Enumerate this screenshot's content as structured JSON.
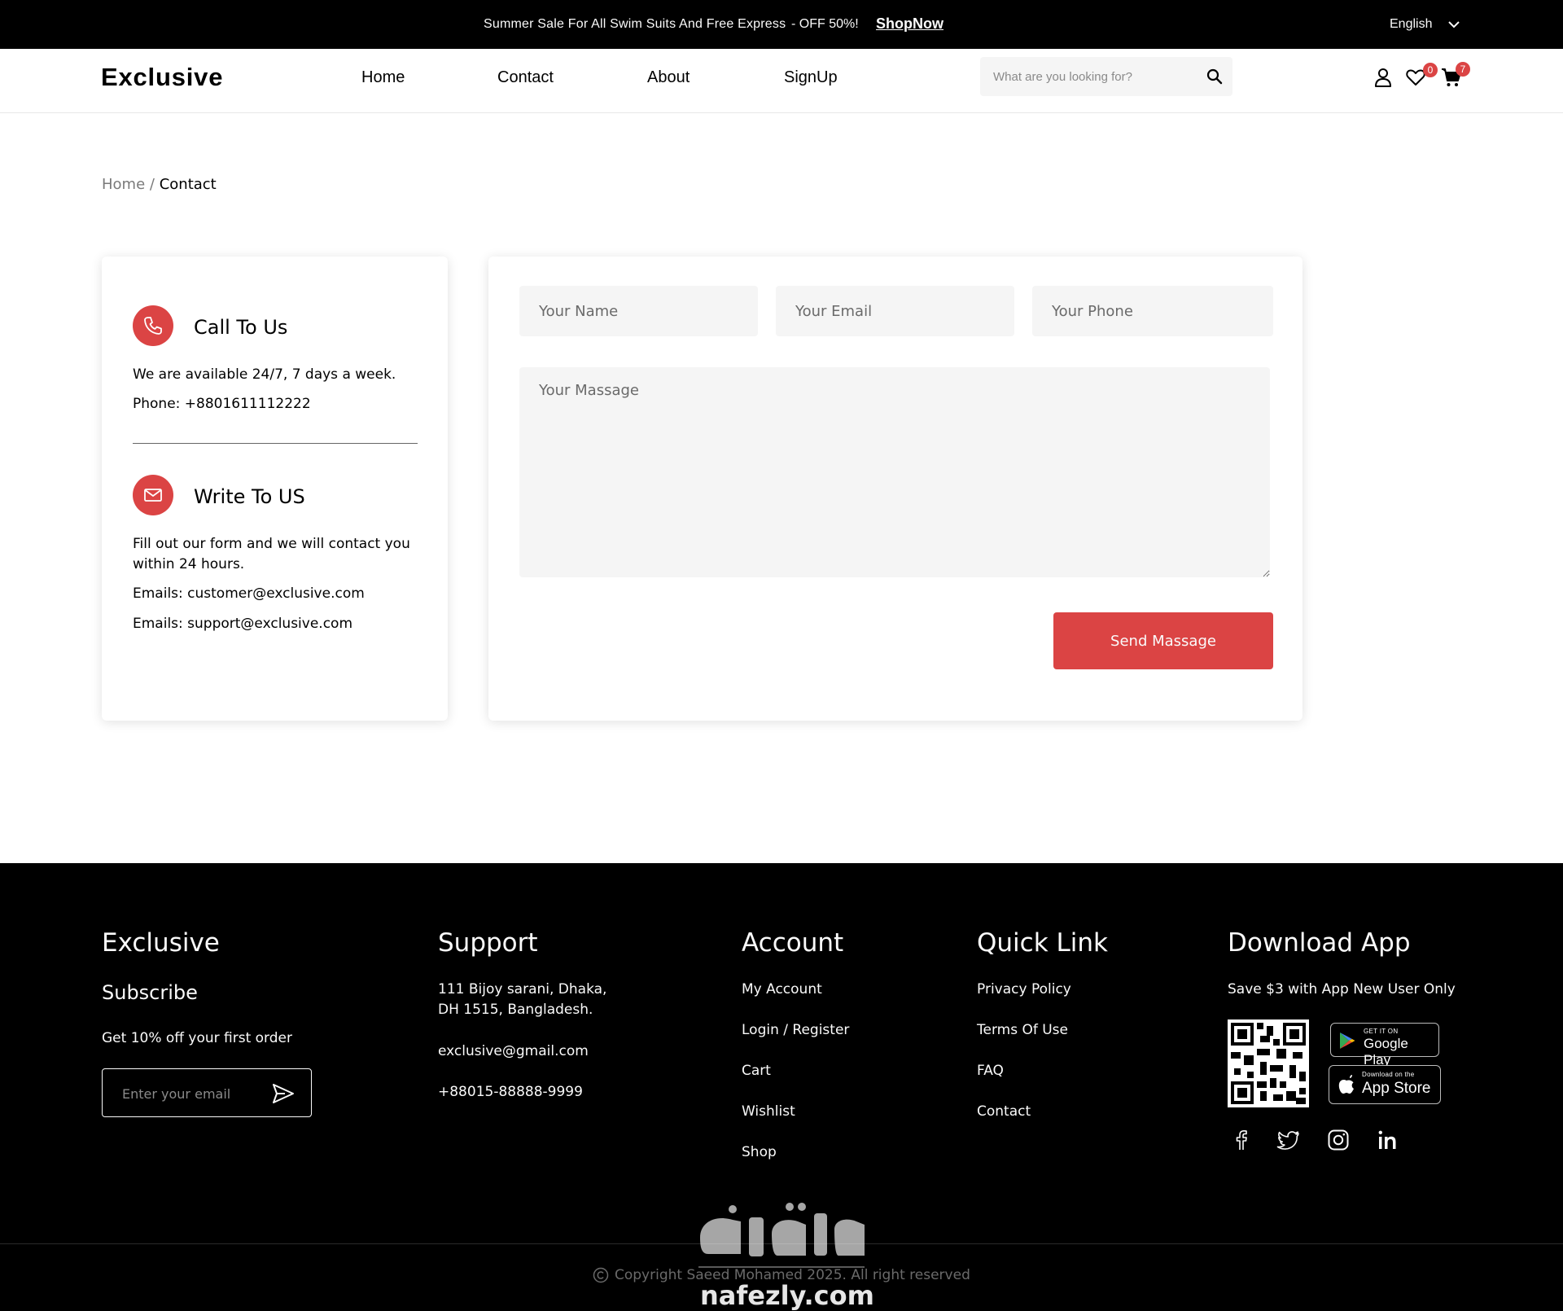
{
  "topbar": {
    "promo": "Summer Sale For All Swim Suits And Free Express",
    "discount": "- OFF 50%!",
    "shop_now": "ShopNow",
    "language": "English"
  },
  "header": {
    "logo": "Exclusive",
    "nav": [
      "Home",
      "Contact",
      "About",
      "SignUp"
    ],
    "search_placeholder": "What are you looking for?",
    "wishlist_count": "0",
    "cart_count": "7"
  },
  "breadcrumb": {
    "home": "Home",
    "separator": "/",
    "current": "Contact"
  },
  "contact_info": {
    "call": {
      "title": "Call To Us",
      "line1": "We are available 24/7, 7 days a week.",
      "line2": "Phone: +8801611112222"
    },
    "write": {
      "title": "Write To US",
      "line1": "Fill out our form and we will contact you within 24 hours.",
      "line2": "Emails: customer@exclusive.com",
      "line3": "Emails: support@exclusive.com"
    }
  },
  "form": {
    "name_placeholder": "Your Name",
    "email_placeholder": "Your Email",
    "phone_placeholder": "Your Phone",
    "message_placeholder": "Your Massage",
    "submit_label": "Send Massage"
  },
  "footer": {
    "brand": {
      "title": "Exclusive",
      "subtitle": "Subscribe",
      "text": "Get 10% off your first order",
      "email_placeholder": "Enter your email"
    },
    "support": {
      "title": "Support",
      "address": "111 Bijoy sarani, Dhaka, DH 1515, Bangladesh.",
      "email": "exclusive@gmail.com",
      "phone": "+88015-88888-9999"
    },
    "account": {
      "title": "Account",
      "links": [
        "My Account",
        "Login / Register",
        "Cart",
        "Wishlist",
        "Shop"
      ]
    },
    "quick_link": {
      "title": "Quick Link",
      "links": [
        "Privacy Policy",
        "Terms Of Use",
        "FAQ",
        "Contact"
      ]
    },
    "download": {
      "title": "Download App",
      "text": "Save $3 with App New User Only",
      "google_small": "GET IT ON",
      "google_big": "Google Play",
      "apple_small": "Download on the",
      "apple_big": "App Store"
    },
    "copyright": "Copyright Saeed Mohamed 2025. All right reserved"
  },
  "watermark": {
    "text": "nafezly.com"
  },
  "colors": {
    "accent": "#db4444",
    "topbar_bg": "#000000",
    "footer_bg": "#000000",
    "input_bg": "#f5f5f5"
  }
}
